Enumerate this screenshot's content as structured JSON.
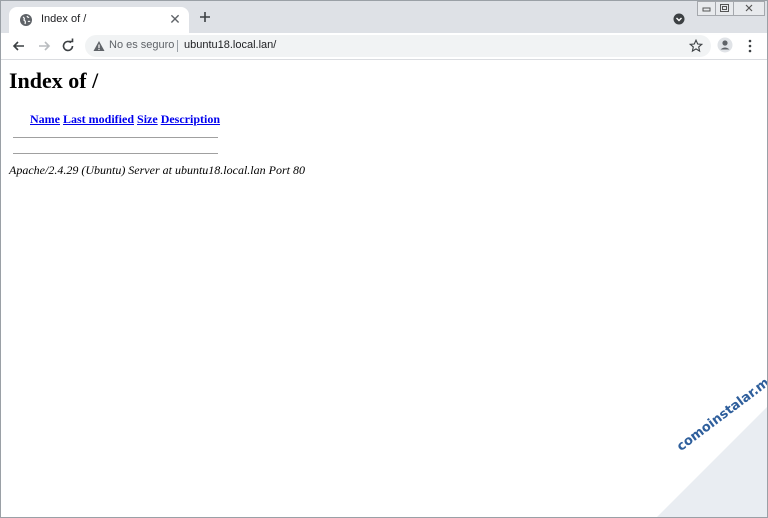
{
  "browser": {
    "tab": {
      "title": "Index of /"
    },
    "address": {
      "security_text": "No es seguro",
      "url": "ubuntu18.local.lan/"
    }
  },
  "page": {
    "heading": "Index of /",
    "columns": [
      "Name",
      "Last modified",
      "Size",
      "Description"
    ],
    "server_signature": "Apache/2.4.29 (Ubuntu) Server at ubuntu18.local.lan Port 80"
  },
  "watermark": "comoinstalar.me",
  "colors": {
    "tabstrip": "#dee1e6",
    "link": "#0000ee",
    "watermark": "#2f5f9c"
  }
}
